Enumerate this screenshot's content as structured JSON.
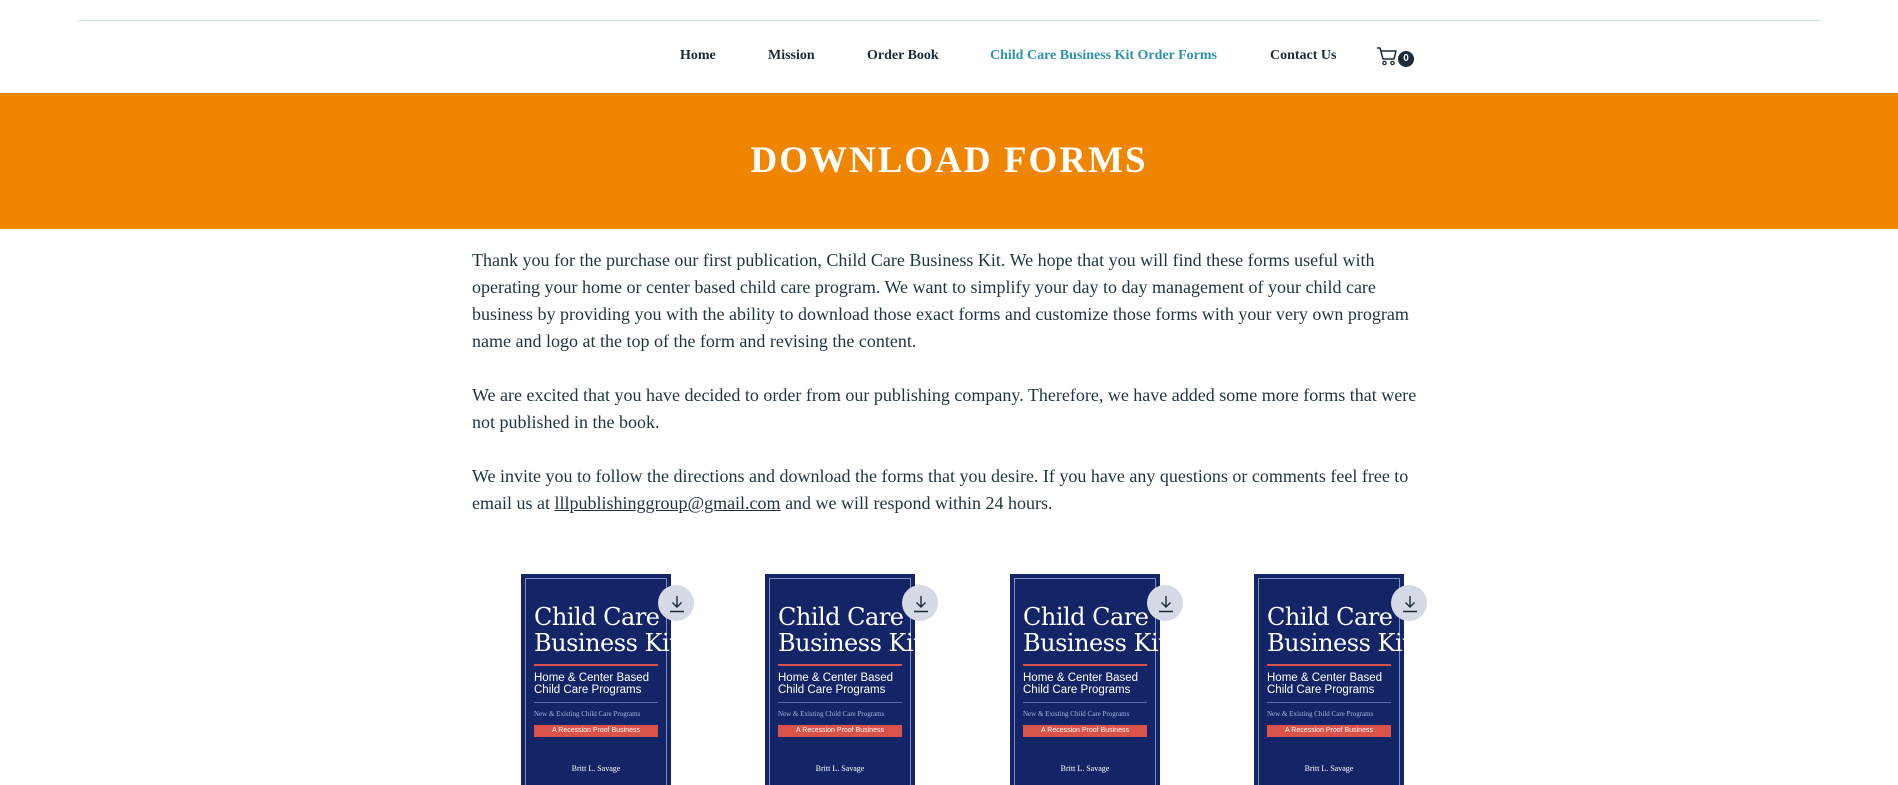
{
  "nav": {
    "items": [
      {
        "label": "Home"
      },
      {
        "label": "Mission"
      },
      {
        "label": "Order Book"
      },
      {
        "label": "Child Care Business Kit Order Forms"
      },
      {
        "label": "Contact Us"
      }
    ],
    "active_index": 3,
    "cart_count": "0",
    "cart_icon": "shopping-cart-icon"
  },
  "banner": {
    "title": "DOWNLOAD FORMS",
    "color": "#f08600"
  },
  "content": {
    "p1": "Thank you for the purchase our first publication, Child Care Business Kit. We hope that you will find these forms useful with operating your home or center based child care program. We want to simplify your day to day management of your child care business by providing you with the ability to download those exact forms and customize those forms with your very own program name and logo at the top of the form and revising the content.",
    "p2": "We are excited that you have decided to order from our publishing company. Therefore, we have added some more forms that were not published in the book.",
    "p3_before": "We invite you to follow the directions and download the forms that you desire. If you have any questions or comments feel free to email us at ",
    "p3_email": "lllpublishinggroup@gmail.com",
    "p3_after": " and we will respond within 24 hours."
  },
  "books": [
    {
      "title_line1": "Child Care",
      "title_line2": "Business Kit",
      "sub_line1": "Home & Center Based",
      "sub_line2": "Child Care Programs",
      "small": "New & Existing Child Care Programs",
      "bar": "A Recession Proof Business",
      "author": "Britt L. Savage",
      "download_icon": "download-icon"
    },
    {
      "title_line1": "Child Care",
      "title_line2": "Business Kit",
      "sub_line1": "Home & Center Based",
      "sub_line2": "Child Care Programs",
      "small": "New & Existing Child Care Programs",
      "bar": "A Recession Proof Business",
      "author": "Britt L. Savage",
      "download_icon": "download-icon"
    },
    {
      "title_line1": "Child Care",
      "title_line2": "Business Kit",
      "sub_line1": "Home & Center Based",
      "sub_line2": "Child Care Programs",
      "small": "New & Existing Child Care Programs",
      "bar": "A Recession Proof Business",
      "author": "Britt L. Savage",
      "download_icon": "download-icon"
    },
    {
      "title_line1": "Child Care",
      "title_line2": "Business Kit",
      "sub_line1": "Home & Center Based",
      "sub_line2": "Child Care Programs",
      "small": "New & Existing Child Care Programs",
      "bar": "A Recession Proof Business",
      "author": "Britt L. Savage",
      "download_icon": "download-icon"
    }
  ]
}
